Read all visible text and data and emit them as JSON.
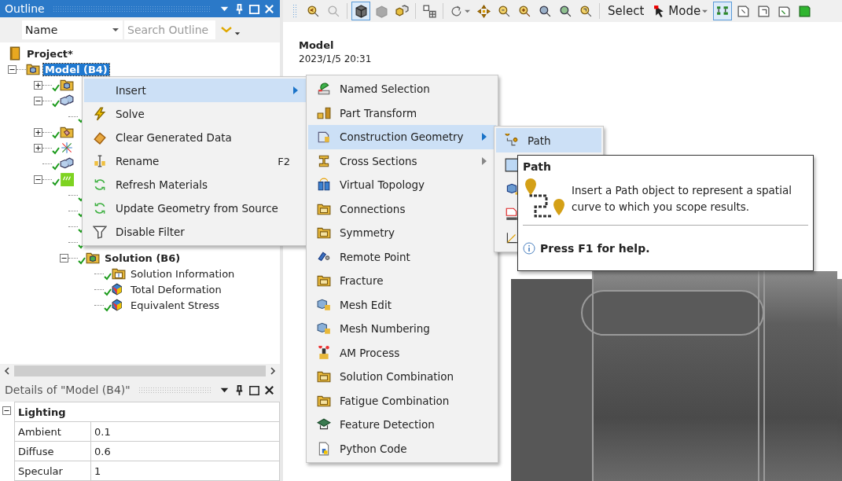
{
  "outline": {
    "title": "Outline",
    "column": "Name",
    "search": {
      "placeholder": "Search Outline"
    },
    "tree": [
      {
        "kind": "project",
        "label": "Project*",
        "selected": false,
        "children": [
          {
            "kind": "model",
            "label": "Model (B4)",
            "selected": true,
            "expanded": true,
            "children": [
              {
                "kind": "geofolder",
                "solved": true,
                "expanded": false
              },
              {
                "kind": "geometry",
                "solved": true,
                "expanded": true,
                "children": [
                  {
                    "kind": "none",
                    "solved": true
                  }
                ]
              },
              {
                "kind": "matfolder",
                "solved": true,
                "expanded": false
              },
              {
                "kind": "coords",
                "solved": true,
                "expanded": false
              },
              {
                "kind": "geometry",
                "solved": true
              },
              {
                "kind": "analysis",
                "solved": true,
                "expanded": true,
                "children": [
                  {
                    "kind": "none",
                    "solved": true
                  },
                  {
                    "kind": "none",
                    "solved": true
                  },
                  {
                    "kind": "none",
                    "solved": true
                  },
                  {
                    "kind": "none",
                    "solved": true
                  },
                  {
                    "kind": "solution",
                    "label": "Solution (B6)",
                    "selected": false,
                    "solved": true,
                    "expanded": true,
                    "children": [
                      {
                        "kind": "info",
                        "label": "Solution Information",
                        "selected": false,
                        "solved": true
                      },
                      {
                        "kind": "result",
                        "label": "Total Deformation",
                        "selected": false,
                        "solved": true
                      },
                      {
                        "kind": "result",
                        "label": "Equivalent Stress",
                        "selected": false,
                        "solved": true
                      }
                    ]
                  }
                ]
              }
            ]
          }
        ]
      }
    ]
  },
  "details": {
    "title": "Details of \"Model (B4)\"",
    "group": {
      "label": "Lighting",
      "expanded": true
    },
    "rows": [
      {
        "name": "Ambient",
        "value": "0.1"
      },
      {
        "name": "Diffuse",
        "value": "0.6"
      },
      {
        "name": "Specular",
        "value": "1"
      }
    ]
  },
  "toolbar": {
    "groups": [
      [
        {
          "kind": "zoomback",
          "pressed": false
        },
        {
          "kind": "zoomgray",
          "pressed": false
        }
      ],
      [
        {
          "kind": "cubeshade",
          "pressed": true
        },
        {
          "kind": "cubegray",
          "pressed": false
        },
        {
          "kind": "cubes",
          "pressed": false
        }
      ],
      [
        {
          "kind": "grid",
          "pressed": false
        }
      ],
      [
        {
          "kind": "rotate",
          "pressed": false,
          "dropdown": true
        },
        {
          "kind": "pan",
          "pressed": false
        },
        {
          "kind": "zoom1",
          "pressed": false
        },
        {
          "kind": "zoomin",
          "pressed": false
        },
        {
          "kind": "zoom2",
          "pressed": false
        },
        {
          "kind": "zoom3",
          "pressed": false
        },
        {
          "kind": "zoom4",
          "pressed": false
        }
      ],
      [
        {
          "kind": "text",
          "label": "Select",
          "pressed": false
        },
        {
          "kind": "mode",
          "label": "Mode",
          "pressed": false,
          "dropdown": true
        },
        {
          "kind": "tree",
          "pressed": true
        },
        {
          "kind": "box1",
          "pressed": false
        },
        {
          "kind": "box2",
          "pressed": false
        },
        {
          "kind": "box3",
          "pressed": false
        },
        {
          "kind": "boxgreen",
          "pressed": false
        }
      ]
    ]
  },
  "viewport": {
    "title": "Model",
    "date": "2023/1/5 20:31"
  },
  "menu": [
    {
      "label": "Insert",
      "selected": true,
      "submenu": true
    },
    {
      "kind": "bolt",
      "label": "Solve",
      "selected": false
    },
    {
      "kind": "eraser",
      "label": "Clear Generated Data",
      "selected": false
    },
    {
      "kind": "rename",
      "label": "Rename",
      "shortcut": "F2",
      "selected": false
    },
    {
      "kind": "refresh",
      "label": "Refresh Materials",
      "selected": false
    },
    {
      "kind": "refresh",
      "label": "Update Geometry from Source",
      "selected": false
    },
    {
      "kind": "filter",
      "label": "Disable Filter",
      "selected": false
    }
  ],
  "insert_menu": [
    {
      "kind": "named",
      "label": "Named Selection",
      "selected": false
    },
    {
      "kind": "transform",
      "label": "Part Transform",
      "selected": false
    },
    {
      "kind": "construction",
      "label": "Construction Geometry",
      "selected": true,
      "submenu": true
    },
    {
      "kind": "cross",
      "label": "Cross Sections",
      "selected": false,
      "submenu": true
    },
    {
      "kind": "topology",
      "label": "Virtual Topology",
      "selected": false
    },
    {
      "kind": "folder",
      "label": "Connections",
      "selected": false
    },
    {
      "kind": "folder",
      "label": "Symmetry",
      "selected": false
    },
    {
      "kind": "remote",
      "label": "Remote Point",
      "selected": false
    },
    {
      "kind": "folder",
      "label": "Fracture",
      "selected": false
    },
    {
      "kind": "mesh",
      "label": "Mesh Edit",
      "selected": false
    },
    {
      "kind": "mesh",
      "label": "Mesh Numbering",
      "selected": false
    },
    {
      "kind": "am",
      "label": "AM Process",
      "selected": false
    },
    {
      "kind": "folder",
      "label": "Solution Combination",
      "selected": false
    },
    {
      "kind": "folder",
      "label": "Fatigue Combination",
      "selected": false
    },
    {
      "kind": "feature",
      "label": "Feature Detection",
      "selected": false
    },
    {
      "kind": "python",
      "label": "Python Code",
      "selected": false
    }
  ],
  "geometry_menu": [
    {
      "kind": "path",
      "label": "Path",
      "selected": true
    },
    {
      "kind": "plane",
      "selected": false
    },
    {
      "kind": "box",
      "selected": false
    },
    {
      "kind": "stl",
      "selected": false
    },
    {
      "kind": "coord",
      "selected": false
    }
  ],
  "tooltip": {
    "title": "Path",
    "text": "Insert a Path object to represent a spatial curve to which you scope results.",
    "help": "Press F1 for help."
  }
}
